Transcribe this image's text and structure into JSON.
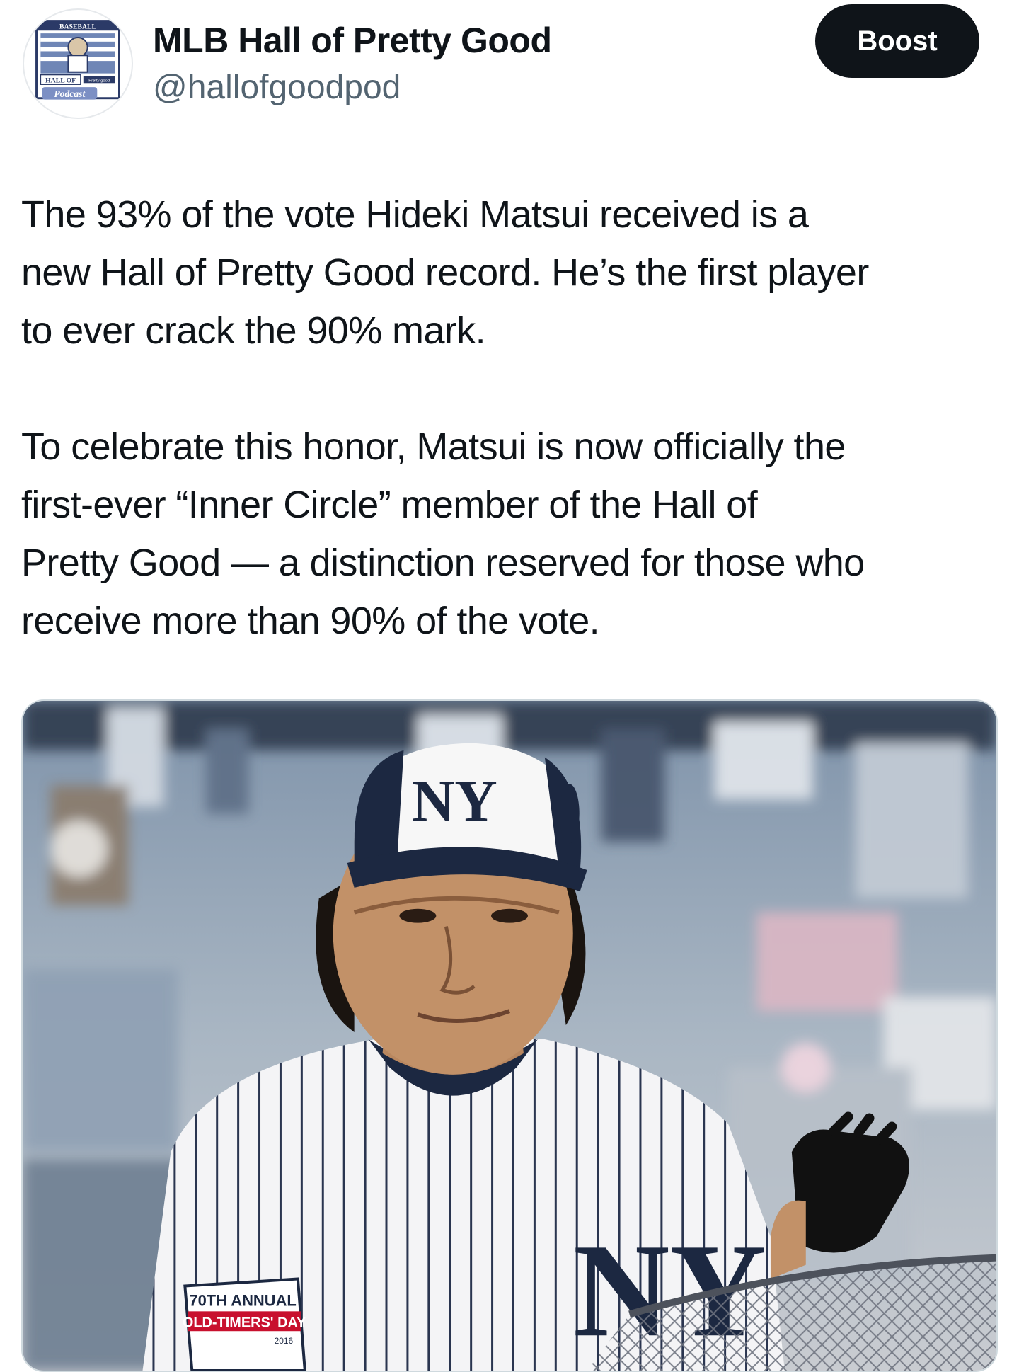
{
  "account": {
    "display_name": "MLB Hall of Pretty Good",
    "handle": "@hallofgoodpod",
    "avatar_text": {
      "top": "BASEBALL",
      "middle": "HALL OF",
      "small": "Pretty good",
      "bottom": "Podcast"
    }
  },
  "actions": {
    "boost_label": "Boost"
  },
  "tweet": {
    "paragraphs": [
      "The 93% of the vote Hideki Matsui received is a\nnew Hall of Pretty Good record. He’s the first player\nto ever crack the 90% mark.",
      "To celebrate this honor, Matsui is now officially the\nfirst-ever “Inner Circle” member of the Hall of\nPretty Good — a distinction reserved for those who\nreceive more than 90% of the vote."
    ]
  },
  "media": {
    "patch_text": {
      "line1": "70TH ANNUAL",
      "line2": "OLD-TIMERS' DAY",
      "year": "2016"
    },
    "cap_logo": "NY",
    "colors": {
      "navy": "#1c2841",
      "white": "#f7f7f7",
      "stadium": "#9fb0c4"
    }
  },
  "colors": {
    "text": "#0f1419",
    "secondary": "#536471",
    "button": "#0f1419"
  }
}
